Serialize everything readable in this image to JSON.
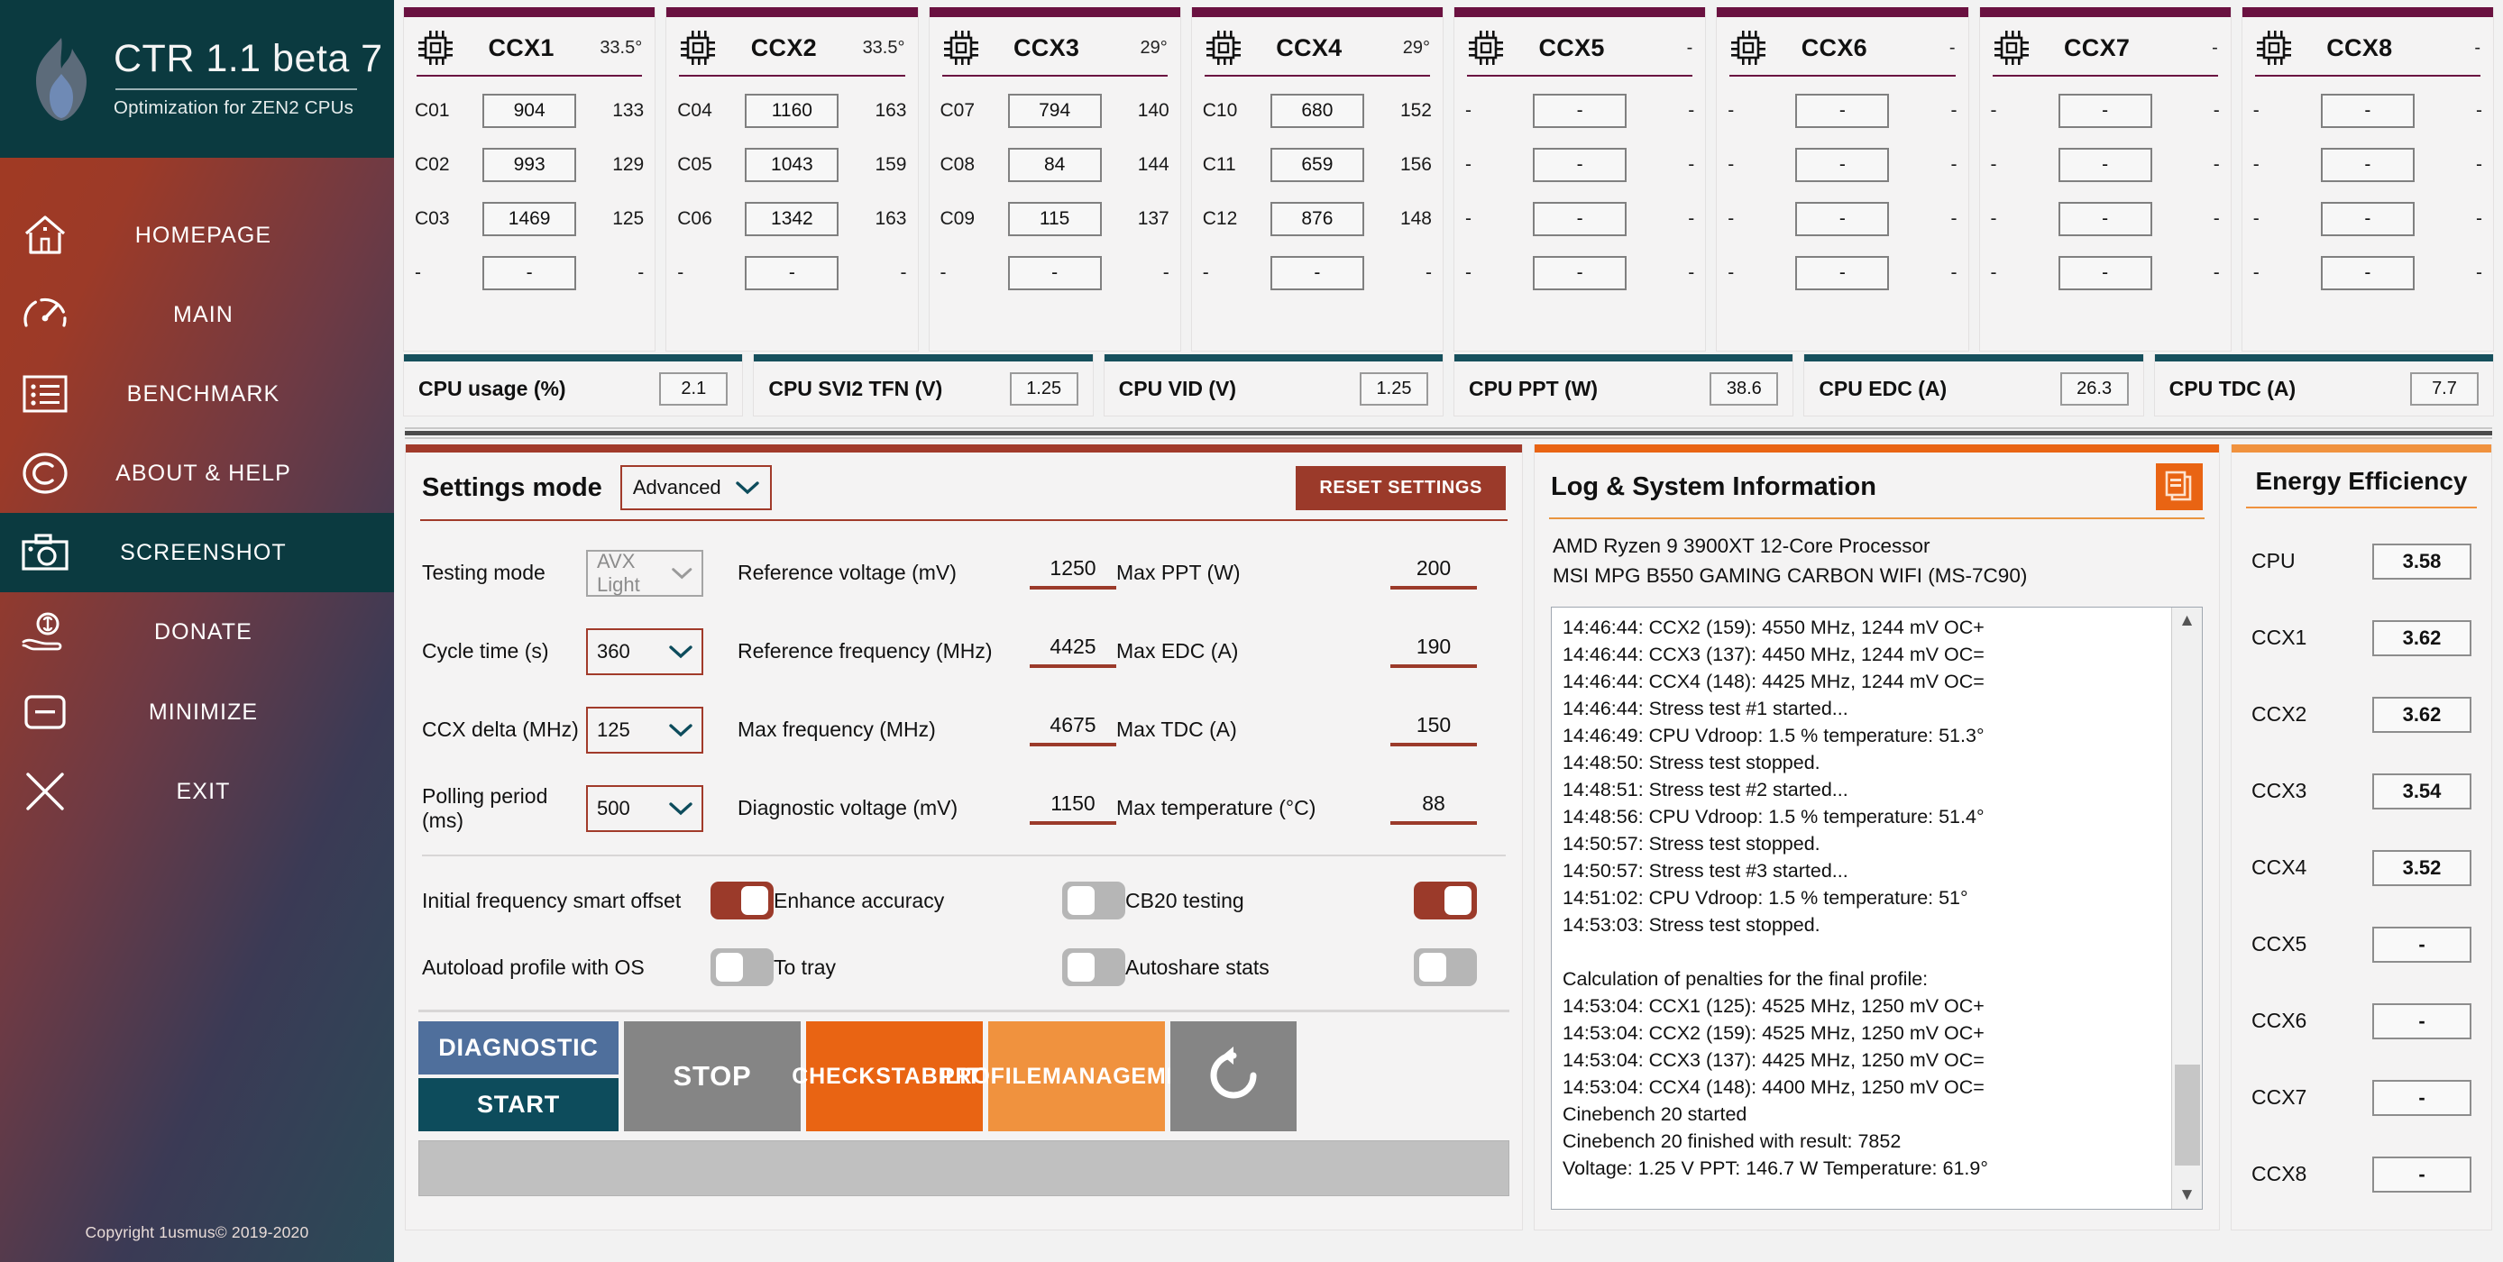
{
  "brand": {
    "title": "CTR 1.1 beta 7",
    "subtitle": "Optimization for ZEN2 CPUs",
    "copyright": "Copyright 1usmus© 2019-2020"
  },
  "sidebar": {
    "items": [
      {
        "label": "HOMEPAGE",
        "icon": "home-icon",
        "active": false
      },
      {
        "label": "MAIN",
        "icon": "gauge-icon",
        "active": false
      },
      {
        "label": "BENCHMARK",
        "icon": "list-icon",
        "active": false
      },
      {
        "label": "ABOUT & HELP",
        "icon": "copyright-icon",
        "active": false
      },
      {
        "label": "SCREENSHOT",
        "icon": "camera-icon",
        "active": true
      },
      {
        "label": "DONATE",
        "icon": "donate-hand-icon",
        "active": false
      },
      {
        "label": "MINIMIZE",
        "icon": "minimize-icon",
        "active": false
      },
      {
        "label": "EXIT",
        "icon": "close-x-icon",
        "active": false
      }
    ]
  },
  "ccx_cards": [
    {
      "name": "CCX1",
      "temp": "33.5°",
      "rows": [
        {
          "core": "C01",
          "value": "904",
          "extra": "133"
        },
        {
          "core": "C02",
          "value": "993",
          "extra": "129"
        },
        {
          "core": "C03",
          "value": "1469",
          "extra": "125"
        },
        {
          "core": "-",
          "value": "-",
          "extra": "-"
        }
      ]
    },
    {
      "name": "CCX2",
      "temp": "33.5°",
      "rows": [
        {
          "core": "C04",
          "value": "1160",
          "extra": "163"
        },
        {
          "core": "C05",
          "value": "1043",
          "extra": "159"
        },
        {
          "core": "C06",
          "value": "1342",
          "extra": "163"
        },
        {
          "core": "-",
          "value": "-",
          "extra": "-"
        }
      ]
    },
    {
      "name": "CCX3",
      "temp": "29°",
      "rows": [
        {
          "core": "C07",
          "value": "794",
          "extra": "140"
        },
        {
          "core": "C08",
          "value": "84",
          "extra": "144"
        },
        {
          "core": "C09",
          "value": "115",
          "extra": "137"
        },
        {
          "core": "-",
          "value": "-",
          "extra": "-"
        }
      ]
    },
    {
      "name": "CCX4",
      "temp": "29°",
      "rows": [
        {
          "core": "C10",
          "value": "680",
          "extra": "152"
        },
        {
          "core": "C11",
          "value": "659",
          "extra": "156"
        },
        {
          "core": "C12",
          "value": "876",
          "extra": "148"
        },
        {
          "core": "-",
          "value": "-",
          "extra": "-"
        }
      ]
    },
    {
      "name": "CCX5",
      "temp": "-",
      "rows": [
        {
          "core": "-",
          "value": "-",
          "extra": "-"
        },
        {
          "core": "-",
          "value": "-",
          "extra": "-"
        },
        {
          "core": "-",
          "value": "-",
          "extra": "-"
        },
        {
          "core": "-",
          "value": "-",
          "extra": "-"
        }
      ]
    },
    {
      "name": "CCX6",
      "temp": "-",
      "rows": [
        {
          "core": "-",
          "value": "-",
          "extra": "-"
        },
        {
          "core": "-",
          "value": "-",
          "extra": "-"
        },
        {
          "core": "-",
          "value": "-",
          "extra": "-"
        },
        {
          "core": "-",
          "value": "-",
          "extra": "-"
        }
      ]
    },
    {
      "name": "CCX7",
      "temp": "-",
      "rows": [
        {
          "core": "-",
          "value": "-",
          "extra": "-"
        },
        {
          "core": "-",
          "value": "-",
          "extra": "-"
        },
        {
          "core": "-",
          "value": "-",
          "extra": "-"
        },
        {
          "core": "-",
          "value": "-",
          "extra": "-"
        }
      ]
    },
    {
      "name": "CCX8",
      "temp": "-",
      "rows": [
        {
          "core": "-",
          "value": "-",
          "extra": "-"
        },
        {
          "core": "-",
          "value": "-",
          "extra": "-"
        },
        {
          "core": "-",
          "value": "-",
          "extra": "-"
        },
        {
          "core": "-",
          "value": "-",
          "extra": "-"
        }
      ]
    }
  ],
  "metrics": [
    {
      "label": "CPU usage (%)",
      "value": "2.1"
    },
    {
      "label": "CPU SVI2 TFN (V)",
      "value": "1.25"
    },
    {
      "label": "CPU VID (V)",
      "value": "1.25"
    },
    {
      "label": "CPU PPT (W)",
      "value": "38.6"
    },
    {
      "label": "CPU EDC (A)",
      "value": "26.3"
    },
    {
      "label": "CPU TDC (A)",
      "value": "7.7"
    }
  ],
  "settings": {
    "title": "Settings mode",
    "mode_value": "Advanced",
    "reset_label": "RESET SETTINGS",
    "col1": [
      {
        "label": "Testing mode",
        "value": "AVX Light",
        "disabled": true
      },
      {
        "label": "Cycle time (s)",
        "value": "360",
        "disabled": false
      },
      {
        "label": "CCX delta (MHz)",
        "value": "125",
        "disabled": false
      },
      {
        "label": "Polling period (ms)",
        "value": "500",
        "disabled": false
      }
    ],
    "col2": [
      {
        "label": "Reference voltage (mV)",
        "value": "1250"
      },
      {
        "label": "Reference frequency (MHz)",
        "value": "4425"
      },
      {
        "label": "Max frequency (MHz)",
        "value": "4675"
      },
      {
        "label": "Diagnostic voltage (mV)",
        "value": "1150"
      }
    ],
    "col3": [
      {
        "label": "Max PPT (W)",
        "value": "200"
      },
      {
        "label": "Max EDC (A)",
        "value": "190"
      },
      {
        "label": "Max TDC (A)",
        "value": "150"
      },
      {
        "label": "Max temperature (°C)",
        "value": "88"
      }
    ],
    "toggles_col1": [
      {
        "label": "Initial frequency smart offset",
        "on": true
      },
      {
        "label": "Autoload profile with OS",
        "on": false
      }
    ],
    "toggles_col2": [
      {
        "label": "Enhance accuracy",
        "on": false
      },
      {
        "label": "To tray",
        "on": false
      }
    ],
    "toggles_col3": [
      {
        "label": "CB20 testing",
        "on": true
      },
      {
        "label": "Autoshare stats",
        "on": false
      }
    ],
    "actions": {
      "diagnostic": "DIAGNOSTIC",
      "start": "START",
      "stop": "STOP",
      "check_stability": "CHECK\nSTABILITY",
      "profile_management": "PROFILE\nMANAGEMENT",
      "refresh_icon": "refresh-icon"
    }
  },
  "log": {
    "title": "Log & System Information",
    "copy_icon": "copy-documents-icon",
    "cpu": "AMD Ryzen 9 3900XT 12-Core Processor",
    "motherboard": "MSI MPG B550 GAMING CARBON WIFI (MS-7C90)",
    "lines": [
      "14:46:44: CCX2 (159): 4550 MHz, 1244 mV  OC+",
      "14:46:44: CCX3 (137): 4450 MHz, 1244 mV  OC=",
      "14:46:44: CCX4 (148): 4425 MHz, 1244 mV  OC=",
      "14:46:44: Stress test #1 started...",
      "14:46:49: CPU Vdroop: 1.5 % temperature: 51.3°",
      "14:48:50: Stress test stopped.",
      "14:48:51: Stress test #2 started...",
      "14:48:56: CPU Vdroop: 1.5 % temperature: 51.4°",
      "14:50:57: Stress test stopped.",
      "14:50:57: Stress test #3 started...",
      "14:51:02: CPU Vdroop: 1.5 % temperature: 51°",
      "14:53:03: Stress test stopped.",
      "",
      "Calculation of penalties for the final profile:",
      "14:53:04: CCX1 (125): 4525 MHz, 1250 mV  OC+",
      "14:53:04: CCX2 (159): 4525 MHz, 1250 mV  OC+",
      "14:53:04: CCX3 (137): 4425 MHz, 1250 mV  OC=",
      "14:53:04: CCX4 (148): 4400 MHz, 1250 mV  OC=",
      "Cinebench 20 started",
      "Cinebench 20 finished with result: 7852",
      "Voltage: 1.25 V  PPT: 146.7 W  Temperature: 61.9°"
    ]
  },
  "energy": {
    "title": "Energy Efficiency",
    "rows": [
      {
        "label": "CPU",
        "value": "3.58"
      },
      {
        "label": "CCX1",
        "value": "3.62"
      },
      {
        "label": "CCX2",
        "value": "3.62"
      },
      {
        "label": "CCX3",
        "value": "3.54"
      },
      {
        "label": "CCX4",
        "value": "3.52"
      },
      {
        "label": "CCX5",
        "value": "-"
      },
      {
        "label": "CCX6",
        "value": "-"
      },
      {
        "label": "CCX7",
        "value": "-"
      },
      {
        "label": "CCX8",
        "value": "-"
      }
    ]
  },
  "colors": {
    "brand_dark": "#0b3a40",
    "ccx_accent": "#6a1140",
    "metric_accent": "#154f5c",
    "settings_accent": "#a13a2a",
    "log_accent": "#e96413",
    "energy_accent": "#f0923e",
    "toggle_on": "#9b3a2a",
    "toggle_off": "#b6b6b6",
    "start_btn": "#0d4c5c",
    "diagnostic_btn": "#4f6f9c",
    "stop_btn": "#858585",
    "check_btn": "#e96413",
    "profile_btn": "#f0923e"
  }
}
